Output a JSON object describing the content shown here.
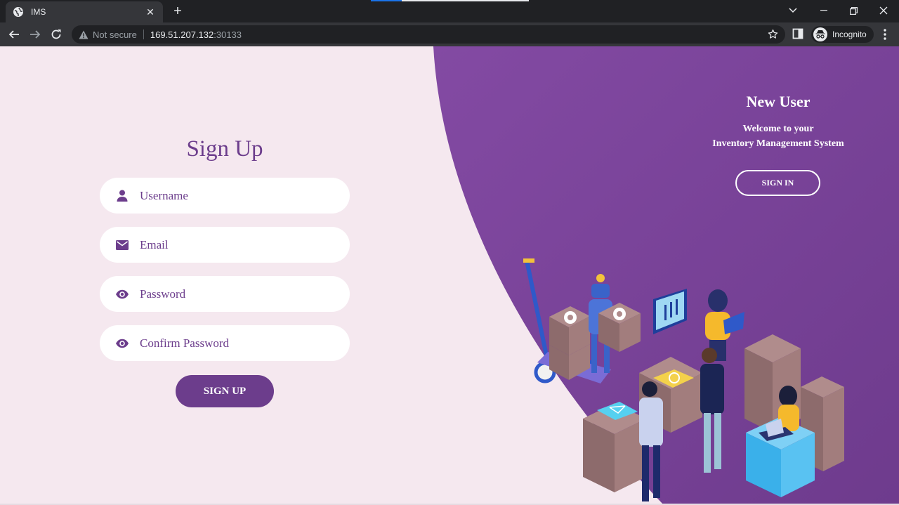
{
  "browser": {
    "tab_title": "IMS",
    "new_tab_label": "+",
    "url_security": "Not secure",
    "url_host": "169.51.207.132",
    "url_port": ":30133",
    "profile_label": "Incognito"
  },
  "signup": {
    "title": "Sign Up",
    "fields": [
      {
        "placeholder": "Username",
        "icon": "user-icon",
        "type": "text"
      },
      {
        "placeholder": "Email",
        "icon": "envelope-icon",
        "type": "email"
      },
      {
        "placeholder": "Password",
        "icon": "eye-icon",
        "type": "password"
      },
      {
        "placeholder": "Confirm Password",
        "icon": "eye-icon",
        "type": "password"
      }
    ],
    "button_label": "SIGN UP"
  },
  "new_user_panel": {
    "title": "New User",
    "line1": "Welcome to your",
    "line2": "Inventory Management System",
    "button_label": "SIGN IN"
  },
  "colors": {
    "accent_purple": "#6c3d8c",
    "panel_purple": "#7a3f98",
    "page_background": "#f5e8ef",
    "input_background": "#ffffff"
  }
}
